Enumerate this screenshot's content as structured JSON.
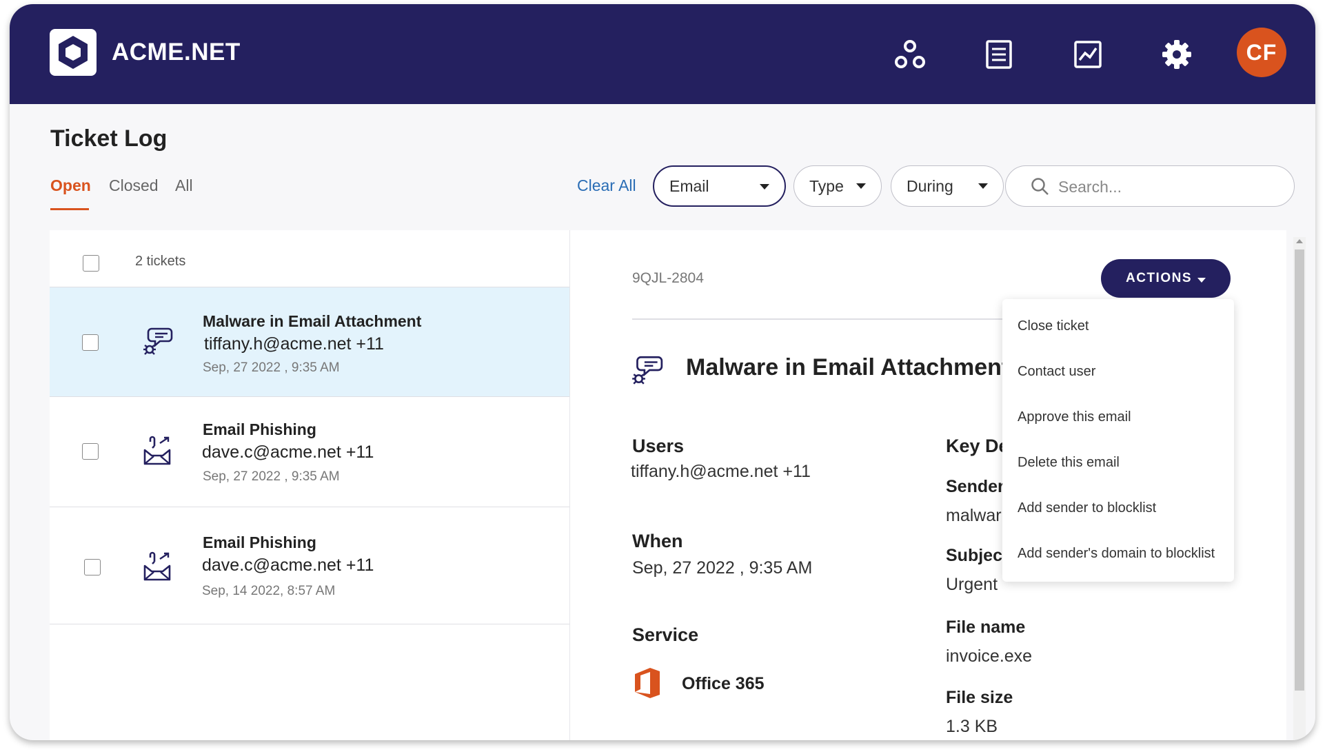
{
  "header": {
    "brand": "ACME.NET",
    "icons": [
      "nodes-icon",
      "list-icon",
      "chart-icon",
      "gear-icon"
    ],
    "avatar_initials": "CF",
    "bg_color": "#24205f",
    "avatar_color": "#d9531e"
  },
  "page": {
    "title": "Ticket Log"
  },
  "tabs": [
    {
      "label": "Open",
      "active": true
    },
    {
      "label": "Closed",
      "active": false
    },
    {
      "label": "All",
      "active": false
    }
  ],
  "filters": {
    "clear_all": "Clear All",
    "email": "Email",
    "type": "Type",
    "during": "During",
    "search_placeholder": "Search..."
  },
  "list": {
    "count": "2 tickets",
    "rows": [
      {
        "title": "Malware in Email Attachment",
        "email": "tiffany.h@acme.net +11",
        "date": "Sep, 27 2022 , 9:35 AM",
        "icon": "malware-icon",
        "selected": true
      },
      {
        "title": "Email Phishing",
        "email": "dave.c@acme.net +11",
        "date": "Sep, 27 2022 , 9:35 AM",
        "icon": "phishing-icon",
        "selected": false
      },
      {
        "title": "Email Phishing",
        "email": "dave.c@acme.net +11",
        "date": "Sep, 14 2022, 8:57 AM",
        "icon": "phishing-icon",
        "selected": false
      }
    ]
  },
  "detail": {
    "id": "9QJL-2804",
    "actions_label": "ACTIONS",
    "title": "Malware in Email Attachment",
    "users_label": "Users",
    "users_value": "tiffany.h@acme.net +11",
    "when_label": "When",
    "when_value": "Sep, 27 2022 , 9:35 AM",
    "service_label": "Service",
    "service_value": "Office 365",
    "key_details_label": "Key De",
    "sender_label": "Sender",
    "sender_value": "malwar",
    "subject_label": "Subject",
    "subject_value": "Urgent",
    "filename_label": "File name",
    "filename_value": "invoice.exe",
    "filesize_label": "File size",
    "filesize_value": "1.3 KB"
  },
  "actions_menu": [
    "Close ticket",
    "Contact user",
    "Approve this email",
    "Delete this email",
    "Add sender to blocklist",
    "Add sender's domain to blocklist"
  ]
}
